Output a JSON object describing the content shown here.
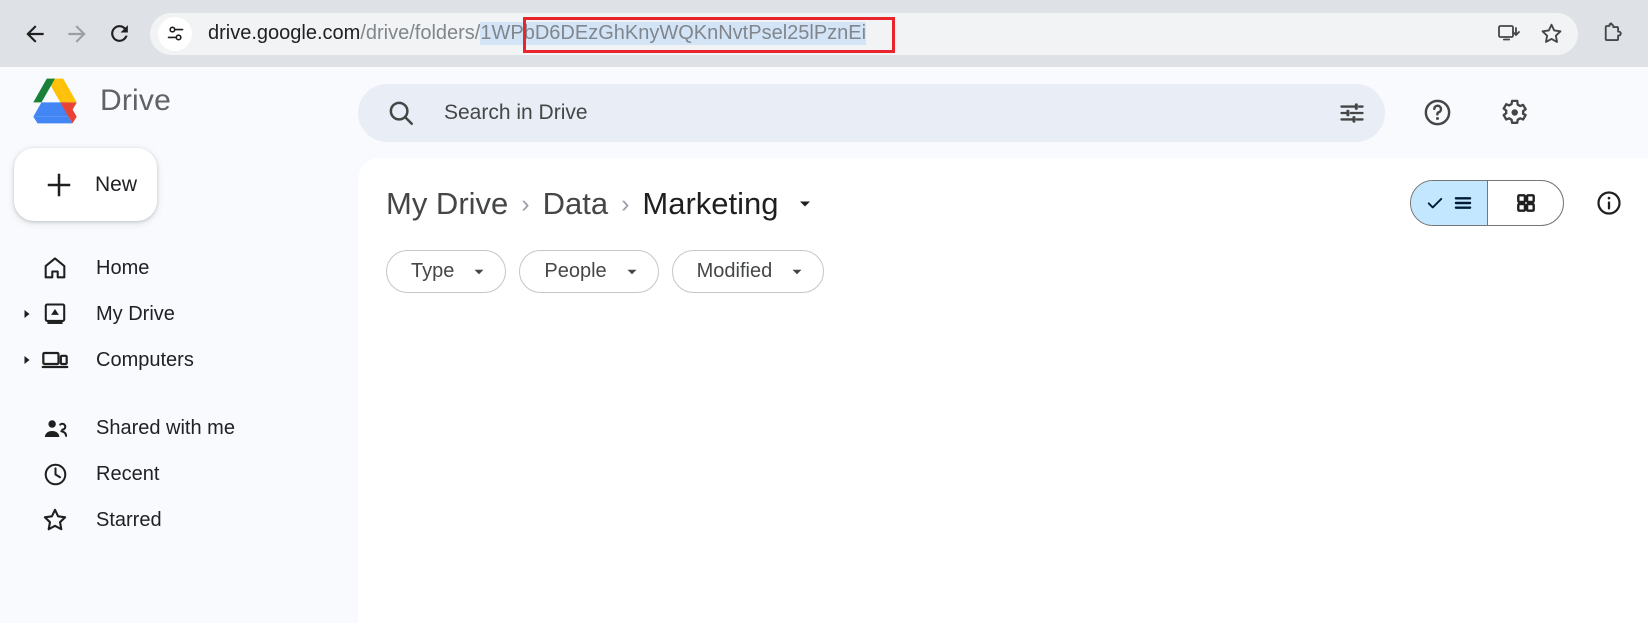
{
  "browser": {
    "back_icon": "arrow-left-icon",
    "forward_icon": "arrow-right-icon",
    "reload_icon": "reload-icon",
    "site_info_icon": "site-settings-icon",
    "url": {
      "domain": "drive.google.com",
      "path": "/drive/folders/",
      "folder_id": "1WPbD6DEzGhKnyWQKnNvtPsel25lPznEi",
      "highlight_color": "#e8252a"
    },
    "install_icon": "install-app-icon",
    "bookmark_icon": "star-outline-icon",
    "extensions_icon": "extensions-puzzle-icon"
  },
  "sidebar": {
    "brand": "Drive",
    "logo_icon": "google-drive-logo",
    "new_button": {
      "label": "New",
      "icon": "plus-icon"
    },
    "items": [
      {
        "label": "Home",
        "icon": "home-icon",
        "expandable": false
      },
      {
        "label": "My Drive",
        "icon": "my-drive-icon",
        "expandable": true
      },
      {
        "label": "Computers",
        "icon": "computers-icon",
        "expandable": true
      },
      {
        "label": "Shared with me",
        "icon": "people-icon",
        "expandable": false
      },
      {
        "label": "Recent",
        "icon": "clock-icon",
        "expandable": false
      },
      {
        "label": "Starred",
        "icon": "star-outline-icon",
        "expandable": false
      }
    ]
  },
  "header": {
    "search": {
      "placeholder": "Search in Drive",
      "search_icon": "search-icon",
      "tune_icon": "tune-options-icon"
    },
    "help_icon": "help-circle-icon",
    "settings_icon": "gear-icon"
  },
  "content": {
    "breadcrumb": [
      {
        "label": "My Drive"
      },
      {
        "label": "Data"
      },
      {
        "label": "Marketing"
      }
    ],
    "breadcrumb_separator": "›",
    "breadcrumb_caret_icon": "chevron-down-icon",
    "filters": [
      {
        "label": "Type",
        "caret_icon": "chevron-down-icon"
      },
      {
        "label": "People",
        "caret_icon": "chevron-down-icon"
      },
      {
        "label": "Modified",
        "caret_icon": "chevron-down-icon"
      }
    ],
    "view_toggle": {
      "list": {
        "icon": "list-view-icon",
        "check_icon": "check-icon",
        "selected": true
      },
      "grid": {
        "icon": "grid-view-icon",
        "selected": false
      },
      "active_color": "#c2e7ff"
    },
    "info_icon": "info-circle-icon",
    "file_list_empty": true
  }
}
